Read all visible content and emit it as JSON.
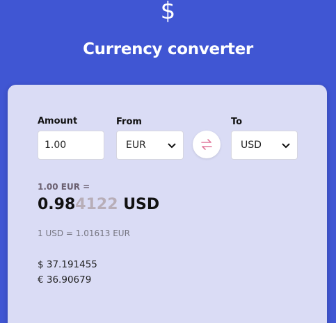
{
  "header": {
    "icon_glyph": "$",
    "title": "Currency converter"
  },
  "form": {
    "amount_label": "Amount",
    "amount_value": "1.00",
    "from_label": "From",
    "from_value": "EUR",
    "to_label": "To",
    "to_value": "USD"
  },
  "result": {
    "label": "1.00 EUR =",
    "value_main": "0.98",
    "value_faded": "4122",
    "currency": "USD",
    "rate": "1 USD = 1.01613 EUR"
  },
  "extra": {
    "line1": "$ 37.191455",
    "line2": "€ 36.90679"
  },
  "colors": {
    "background": "#4056d3",
    "card": "#dadcf5",
    "swap_icon": "#e27a9d"
  }
}
